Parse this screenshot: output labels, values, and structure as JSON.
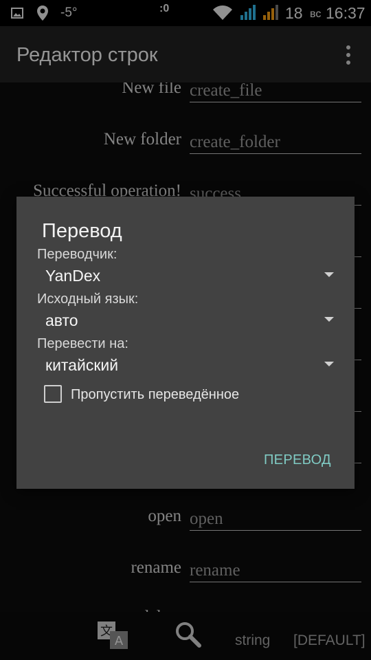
{
  "status_bar": {
    "temperature": "-5°",
    "notification_count": ":0",
    "battery_level": "18",
    "day": "вс",
    "time": "16:37"
  },
  "app_bar": {
    "title": "Редактор строк",
    "overflow_icon": "more-vert-icon"
  },
  "rows": [
    {
      "label": "New file",
      "value": "create_file"
    },
    {
      "label": "New folder",
      "value": "create_folder"
    },
    {
      "label": "Successful operation!",
      "value": "success"
    },
    {
      "label": "",
      "value": ""
    },
    {
      "label": "",
      "value": ""
    },
    {
      "label": "",
      "value": ""
    },
    {
      "label": "",
      "value": ""
    },
    {
      "label": "",
      "value": ""
    },
    {
      "label": "open",
      "value": "open"
    },
    {
      "label": "rename",
      "value": "rename"
    },
    {
      "label": "delete",
      "value": ""
    }
  ],
  "dialog": {
    "title": "Перевод",
    "translator_label": "Переводчик:",
    "translator_value": "YanDex",
    "source_label": "Исходный язык:",
    "source_value": "авто",
    "target_label": "Перевести на:",
    "target_value": "китайский",
    "skip_label": "Пропустить переведённое",
    "skip_checked": false,
    "translate_button": "ПЕРЕВОД",
    "accent_color": "#80cbc4"
  },
  "bottom_bar": {
    "translate_icon": "translate-icon",
    "search_icon": "search-icon",
    "string_label": "string",
    "default_label": "[DEFAULT]"
  }
}
